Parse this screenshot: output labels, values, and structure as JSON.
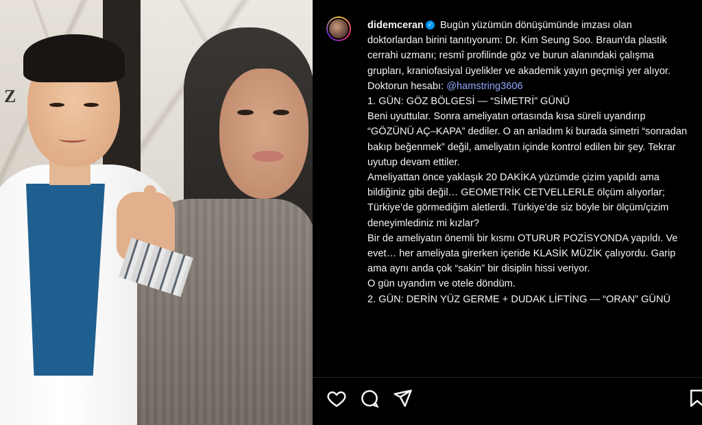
{
  "post": {
    "username": "didemceran",
    "verified_mark": "✓",
    "caption": {
      "intro": "Bugün yüzümün dönüşümünde imzası olan doktorlardan birini tanıtıyorum: Dr. Kim Seung Soo. Braun'da plastik cerrahi uzmanı; resmî profilinde göz ve burun alanındaki çalışma grupları, kraniofasiyal üyelikler ve akademik yayın geçmişi yer alıyor. Doktorun hesabı: ",
      "mention": "@hamstring3606",
      "day1_title": "1. GÜN: GÖZ BÖLGESİ — “SİMETRİ” GÜNÜ",
      "day1_text": "Beni uyuttular. Sonra ameliyatın ortasında kısa süreli uyandırıp “GÖZÜNÜ AÇ–KAPA” dediler. O an anladım ki burada simetri “sonradan bakıp beğenmek” değil, ameliyatın içinde kontrol edilen bir şey. Tekrar uyutup devam ettiler.",
      "para2": "Ameliyattan önce yaklaşık 20 DAKİKA yüzümde çizim yapıldı ama bildiğiniz gibi değil… GEOMETRİK CETVELLERLE ölçüm alıyorlar; Türkiye’de görmediğim aletlerdi. Türkiye’de siz böyle bir ölçüm/çizim deneyimlediniz mi kızlar?",
      "para3": "Bir de ameliyatın önemli bir kısmı OTURUR POZİSYONDA yapıldı. Ve evet… her ameliyata girerken içeride KLASİK MÜZİK çalıyordu. Garip ama aynı anda çok “sakin” bir disiplin hissi veriyor.",
      "para4": "O gün uyandım ve otele döndüm.",
      "day2_title": "2. GÜN: DERİN YÜZ GERME + DUDAK LİFTİNG — “ORAN” GÜNÜ"
    }
  },
  "photo": {
    "wall_sign": "Z"
  },
  "actions": {
    "like": "heart-icon",
    "comment": "comment-icon",
    "share": "share-icon",
    "save": "bookmark-icon"
  },
  "colors": {
    "background": "#000000",
    "text": "#f5f5f5",
    "mention": "#8fa8ff",
    "verified": "#0095f6"
  }
}
